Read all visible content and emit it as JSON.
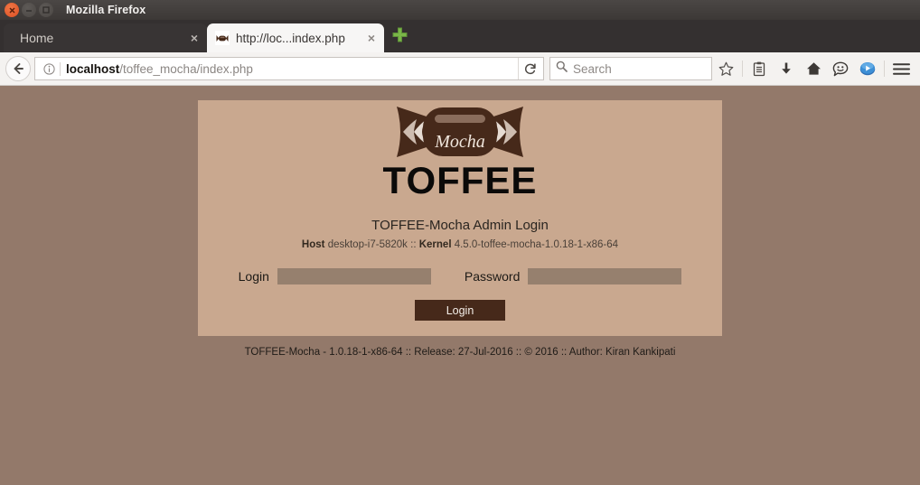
{
  "window": {
    "title": "Mozilla Firefox",
    "controls": [
      {
        "name": "close",
        "glyph": "x"
      },
      {
        "name": "minimize",
        "glyph": "-"
      },
      {
        "name": "maximize",
        "glyph": "[]"
      }
    ]
  },
  "tabs": [
    {
      "label": "Home",
      "close_label": "×",
      "active": false
    },
    {
      "label": "http://loc...index.php",
      "close_label": "×",
      "active": true,
      "favicon": "toffee-candy-icon"
    }
  ],
  "newtab": {
    "label": "+",
    "icon": "plus-icon",
    "color": "#7ab648"
  },
  "toolbar": {
    "back_icon": "back-arrow-icon",
    "identity_icon": "info-circle-icon",
    "url_host": "localhost",
    "url_path": "/toffee_mocha/index.php",
    "reload_icon": "reload-icon",
    "search_icon": "magnifier-icon",
    "search_placeholder": "Search",
    "search_value": "",
    "icons": [
      {
        "name": "bookmark-star-icon",
        "label": "Bookmark this page"
      },
      {
        "name": "reading-list-icon",
        "label": "Show your reading list"
      },
      {
        "name": "download-icon",
        "label": "Downloads"
      },
      {
        "name": "home-icon",
        "label": "Home"
      },
      {
        "name": "hello-chat-icon",
        "label": "Firefox Hello"
      },
      {
        "name": "pocket-icon",
        "label": "Save to Pocket"
      },
      {
        "name": "menu-hamburger-icon",
        "label": "Open menu"
      }
    ]
  },
  "page": {
    "background_color": "#93796a",
    "card_color": "#c9a88f",
    "logo": {
      "candy_label": "Mocha",
      "wordmark": "TOFFEE",
      "candy_color": "#46291a",
      "candy_highlight": "#8a6d5c"
    },
    "headline": "TOFFEE-Mocha Admin Login",
    "subline": {
      "host_label": "Host",
      "host_value": "desktop-i7-5820k",
      "separator": "::",
      "kernel_label": "Kernel",
      "kernel_value": "4.5.0-toffee-mocha-1.0.18-1-x86-64"
    },
    "form": {
      "login_label": "Login",
      "login_value": "",
      "login_placeholder": "",
      "password_label": "Password",
      "password_value": "",
      "password_placeholder": "",
      "submit_label": "Login",
      "submit_color": "#46291a",
      "field_color": "#96806e"
    },
    "footer": "TOFFEE-Mocha - 1.0.18-1-x86-64 :: Release: 27-Jul-2016 :: © 2016 :: Author: Kiran Kankipati"
  }
}
